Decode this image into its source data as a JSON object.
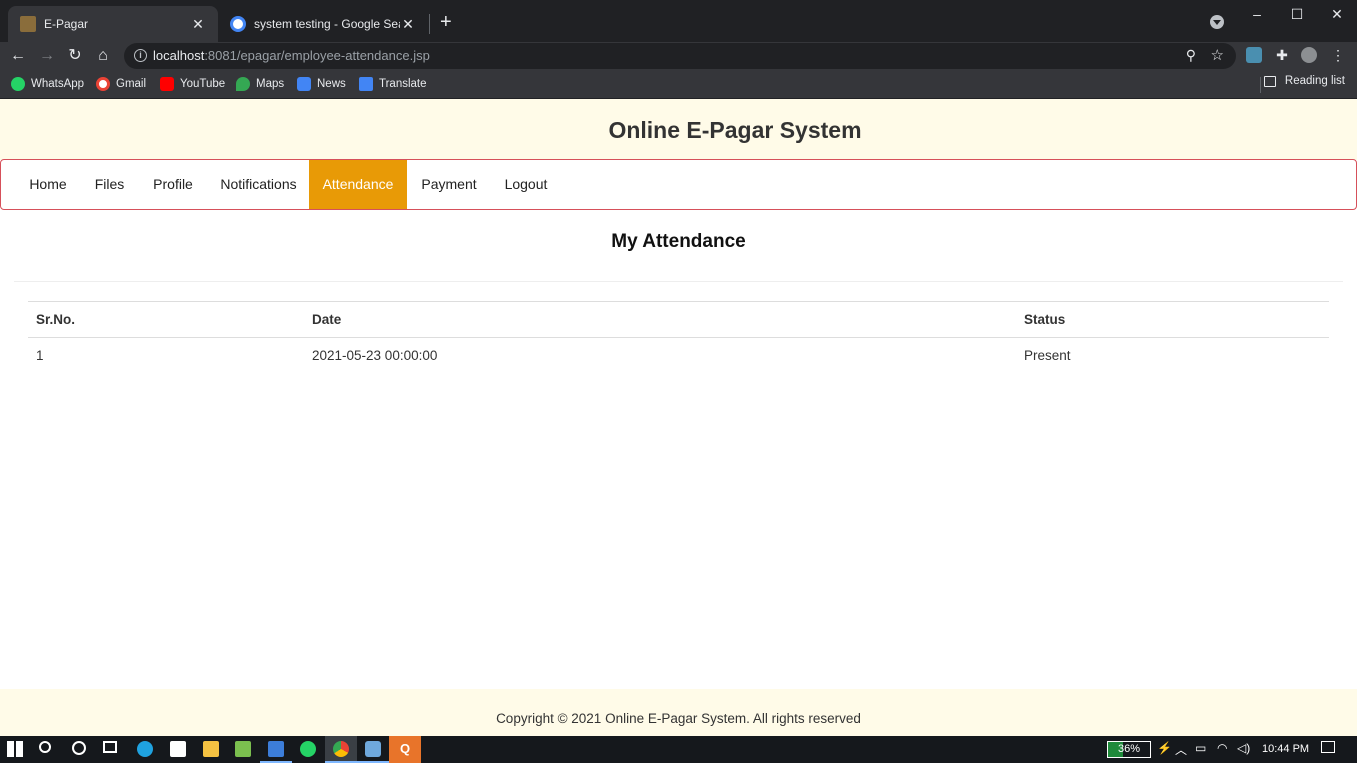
{
  "browser": {
    "tabs": [
      {
        "title": "E-Pagar",
        "active": true
      },
      {
        "title": "system testing - Google Search",
        "active": false
      }
    ],
    "url_host": "localhost",
    "url_rest": ":8081/epagar/employee-attendance.jsp",
    "bookmarks": [
      "WhatsApp",
      "Gmail",
      "YouTube",
      "Maps",
      "News",
      "Translate"
    ],
    "reading_list": "Reading list"
  },
  "site": {
    "title": "Online E-Pagar System",
    "nav": [
      "Home",
      "Files",
      "Profile",
      "Notifications",
      "Attendance",
      "Payment",
      "Logout"
    ],
    "active_nav": "Attendance",
    "colors": {
      "header_bg": "#fffbe8",
      "nav_active": "#e89a06",
      "nav_border": "#d6505a"
    }
  },
  "main": {
    "heading": "My Attendance",
    "table": {
      "headers": [
        "Sr.No.",
        "Date",
        "Status"
      ],
      "rows": [
        [
          "1",
          "2021-05-23 00:00:00",
          "Present"
        ]
      ]
    }
  },
  "footer": {
    "text": "Copyright © 2021 Online E-Pagar System. All rights reserved"
  },
  "taskbar": {
    "battery": "36%",
    "battery_level": 0.36,
    "time": "10:44 PM"
  }
}
